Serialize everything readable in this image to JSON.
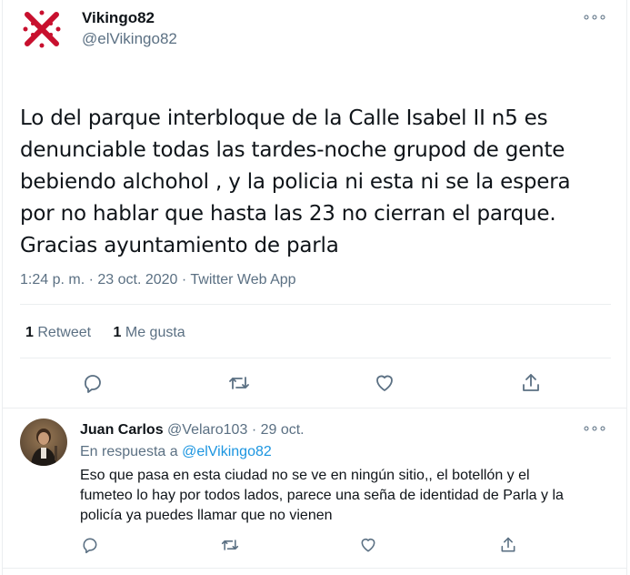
{
  "main_tweet": {
    "author_name": "Vikingo82",
    "author_handle": "@elVikingo82",
    "text_lines": [
      "Lo del parque interbloque de la Calle Isabel II n5 es",
      "denunciable  todas las tardes-noche grupod de gente",
      "bebiendo alchohol , y la policia ni esta ni se la espera",
      "por no hablar que hasta las 23 no cierran el parque.",
      "Gracias ayuntamiento de parla"
    ],
    "meta": "1:24 p. m. · 23 oct. 2020 · Twitter Web App",
    "retweet_count": "1",
    "retweet_label": "Retweet",
    "like_count": "1",
    "like_label": "Me gusta",
    "more_glyph": "∘∘∘"
  },
  "reply": {
    "author_name": "Juan Carlos",
    "author_handle": "@Velaro103",
    "date": "· 29 oct.",
    "in_reply_to_label": "En respuesta a",
    "in_reply_to_handle": "@elVikingo82",
    "text_lines": [
      "Eso que pasa en esta ciudad no se ve en ningún sitio,, el botellón y el",
      "fumeteo lo hay por todos lados, parece una seña de identidad de Parla y la",
      "policía ya puedes llamar que no vienen"
    ],
    "more_glyph": "∘∘∘"
  },
  "icons": {
    "reply": "reply-icon",
    "retweet": "retweet-icon",
    "like": "heart-icon",
    "share": "share-icon",
    "more": "more-icon"
  },
  "colors": {
    "text": "#0f1419",
    "secondary": "#5b7083",
    "link": "#1b95e0",
    "divider": "#ebeef0",
    "avatar_cross": "#c8102e"
  }
}
